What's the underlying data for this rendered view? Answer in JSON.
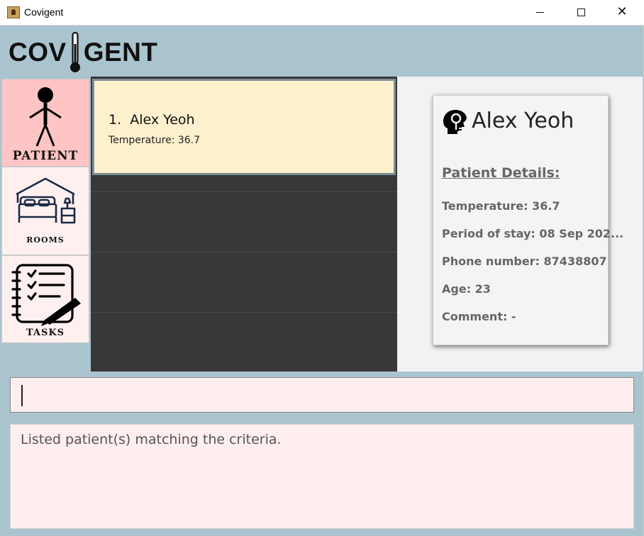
{
  "window": {
    "title": "Covigent"
  },
  "logo": {
    "left_text": "COV",
    "right_text": "GENT"
  },
  "sidebar": {
    "items": [
      {
        "label": "PATIENT",
        "icon": "stick-figure-icon"
      },
      {
        "label": "ROOMS",
        "icon": "bedroom-icon"
      },
      {
        "label": "TASKS",
        "icon": "checklist-icon"
      }
    ]
  },
  "patient_list": {
    "items": [
      {
        "index": "1.",
        "name": "Alex Yeoh",
        "temperature": "Temperature: 36.7"
      }
    ]
  },
  "details": {
    "name": "Alex Yeoh",
    "heading": "Patient Details:",
    "rows": [
      "Temperature: 36.7",
      "Period of stay: 08 Sep 202...",
      "Phone number: 87438807",
      "Age: 23",
      "Comment: -"
    ]
  },
  "command": {
    "value": ""
  },
  "result": {
    "message": "Listed patient(s) matching the criteria."
  },
  "colors": {
    "background": "#aac4cf",
    "patient_active": "#ffc4c4",
    "sidebar_inactive": "#fff0f0",
    "list_card": "#fff0cd",
    "list_bg": "#383838"
  }
}
